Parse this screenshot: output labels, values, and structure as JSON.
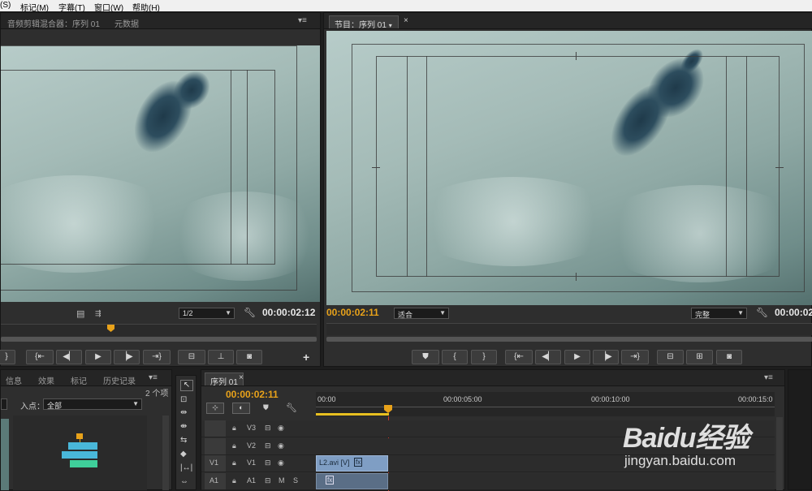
{
  "menu": [
    "(S)",
    "标记(M)",
    "字幕(T)",
    "窗口(W)",
    "帮助(H)"
  ],
  "source_panel": {
    "tabs": [
      "音频剪辑混合器：序列 01",
      "元数据"
    ],
    "timecode": "00:00:02:12",
    "resolution": "1/2"
  },
  "program_panel": {
    "tab": "节目：序列 01",
    "timecode": "00:00:02:11",
    "fit": "适合",
    "quality": "完整",
    "right_timecode": "00:00:02"
  },
  "project_panel": {
    "tabs": [
      "信息",
      "效果",
      "标记",
      "历史记录"
    ],
    "item_count": "2 个项",
    "inpoint_label": "入点：",
    "inpoint_value": "全部"
  },
  "timeline": {
    "tab": "序列 01",
    "timecode": "00:00:02:11",
    "ruler_labels": [
      "00:00",
      "00:00:05:00",
      "00:00:10:00",
      "00:00:15:0"
    ],
    "tracks": [
      {
        "src": "",
        "name": "V3"
      },
      {
        "src": "",
        "name": "V2"
      },
      {
        "src": "V1",
        "name": "V1"
      },
      {
        "src": "A1",
        "name": "A1"
      }
    ],
    "clip_label": "L2.avi [V]"
  },
  "watermark": {
    "logo": "Baidu经验",
    "url": "jingyan.baidu.com"
  },
  "colors": {
    "accent": "#e8a21a",
    "clip_video": "#7f9ec4",
    "clip_audio": "#5a6e86",
    "playhead": "#d0392b"
  }
}
